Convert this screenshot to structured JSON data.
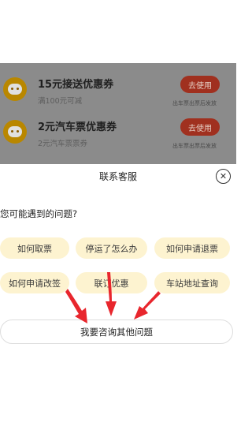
{
  "coupons": [
    {
      "title": "15元接送优惠券",
      "subtitle": "满100元可减",
      "button": "去使用",
      "note": "出车票出票后发放"
    },
    {
      "title": "2元汽车票优惠券",
      "subtitle": "2元汽车票票券",
      "button": "去使用",
      "note": "出车票出票后发放"
    }
  ],
  "sheet": {
    "title": "联系客服",
    "close_glyph": "✕",
    "prompt": "您可能遇到的问题?",
    "chips": [
      "如何取票",
      "停运了怎么办",
      "如何申请退票",
      "如何申请改签",
      "联订优惠",
      "车站地址查询"
    ],
    "other_button": "我要咨询其他问题"
  },
  "colors": {
    "overlay": "#8b8b8b",
    "use_button": "#a0301f",
    "chip_bg": "#fdf3d0",
    "arrow": "#e8262d"
  },
  "icons": {
    "coupon_icon": "piggy-icon",
    "close": "close-icon",
    "annotation": "red-arrow-icon"
  }
}
